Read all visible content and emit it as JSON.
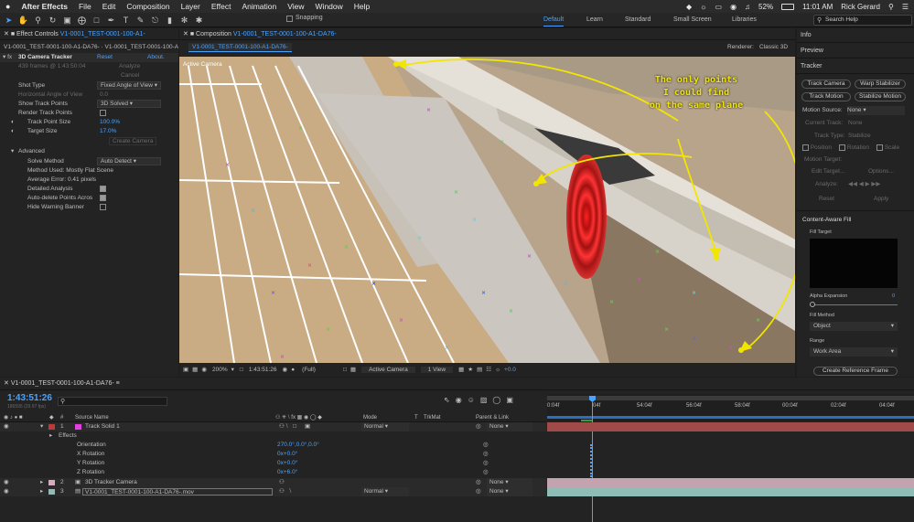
{
  "menubar": {
    "apple": "",
    "app": "After Effects",
    "items": [
      "File",
      "Edit",
      "Composition",
      "Layer",
      "Effect",
      "Animation",
      "View",
      "Window",
      "Help"
    ],
    "battery": "52%",
    "time": "11:01 AM",
    "user": "Rick Gerard"
  },
  "toolbar": {
    "snapping": "Snapping",
    "workspaces": [
      "Default",
      "Learn",
      "Standard",
      "Small Screen",
      "Libraries"
    ],
    "search_placeholder": "Search Help"
  },
  "effect_panel": {
    "tab": "Effect Controls",
    "tab_layer": "V1-0001_TEST-0001-100-A1-",
    "breadcrumb": "V1-0001_TEST-0001-100-A1-DA76- · V1-0001_TEST-0001-100-A",
    "effect_name": "3D Camera Tracker",
    "reset": "Reset",
    "about": "About.",
    "frames_info": "439 frames @ 1:43:50:04",
    "analyze": "Analyze",
    "cancel": "Cancel",
    "shot_type_label": "Shot Type",
    "shot_type_value": "Fixed Angle of View",
    "hfov_label": "Horizontal Angle of View",
    "hfov_value": "0.0",
    "show_track_points_label": "Show Track Points",
    "show_track_points_value": "3D Solved",
    "render_track_points_label": "Render Track Points",
    "track_point_size_label": "Track Point Size",
    "track_point_size_value": "100.0%",
    "target_size_label": "Target Size",
    "target_size_value": "17.0%",
    "create_camera": "Create Camera",
    "advanced_label": "Advanced",
    "solve_method_label": "Solve Method",
    "solve_method_value": "Auto Detect",
    "method_used": "Method Used: Mostly Flat Scene",
    "average_error": "Average Error: 0.41 pixels",
    "detailed_analysis": "Detailed Analysis",
    "auto_delete": "Auto-delete Points Acros",
    "hide_warning": "Hide Warning Banner"
  },
  "comp_panel": {
    "tab": "Composition",
    "tab_name": "V1-0001_TEST-0001-100-A1-DA76-",
    "subtab": "V1-0001_TEST-0001-100-A1-DA76-",
    "renderer_label": "Renderer:",
    "renderer_value": "Classic 3D",
    "camera_label": "Active Camera",
    "annotation_lines": [
      "The only points",
      "I could find",
      "on the same plane"
    ],
    "zoom": "200%",
    "timecode": "1:43:51:26",
    "resolution": "(Full)",
    "active_camera": "Active Camera",
    "view_layout": "1 View",
    "exposure": "+0.0"
  },
  "right_panel": {
    "info": "Info",
    "preview": "Preview",
    "tracker": "Tracker",
    "track_camera": "Track Camera",
    "warp_stabilizer": "Warp Stabilizer",
    "track_motion": "Track Motion",
    "stabilize_motion": "Stabilize Motion",
    "motion_source_label": "Motion Source:",
    "motion_source_value": "None",
    "current_track_label": "Current Track:",
    "current_track_value": "None",
    "track_type_label": "Track Type:",
    "track_type_value": "Stabilize",
    "position": "Position",
    "rotation": "Rotation",
    "scale": "Scale",
    "motion_target": "Motion Target:",
    "edit_target": "Edit Target...",
    "options": "Options...",
    "analyze": "Analyze:",
    "reset": "Reset",
    "apply": "Apply",
    "caf": "Content-Aware Fill",
    "fill_target": "Fill Target",
    "alpha_expansion": "Alpha Expansion",
    "alpha_value": "0",
    "fill_method": "Fill Method",
    "fill_method_value": "Object",
    "range": "Range",
    "range_value": "Work Area",
    "create_reference_frame": "Create Reference Frame"
  },
  "timeline": {
    "tab": "V1-0001_TEST-0001-100-A1-DA76-",
    "timecode": "1:43:51:26",
    "frame_info": "186595 (29.97 fps)",
    "search_placeholder": "",
    "col_source_name": "Source Name",
    "col_mode": "Mode",
    "col_t": "T",
    "col_trkmat": "TrkMat",
    "col_parent": "Parent & Link",
    "ruler": [
      "0:04f",
      "04f",
      "54:04f",
      "56:04f",
      "58:04f",
      "00:04f",
      "02:04f",
      "04:04f"
    ],
    "layers": [
      {
        "num": "1",
        "name": "Track Solid 1",
        "mode": "Normal",
        "parent": "None"
      },
      {
        "num": "2",
        "name": "3D Tracker Camera",
        "mode": "",
        "parent": "None"
      },
      {
        "num": "3",
        "name": "V1-0001_TEST-0001-100-A1-DA76-.mov",
        "mode": "Normal",
        "parent": "None"
      }
    ],
    "effects_label": "Effects",
    "props": [
      {
        "name": "Orientation",
        "value": "270.0°,0.0°,0.0°"
      },
      {
        "name": "X Rotation",
        "value": "0x+0.0°"
      },
      {
        "name": "Y Rotation",
        "value": "0x+0.0°"
      },
      {
        "name": "Z Rotation",
        "value": "0x+6.0°"
      }
    ]
  },
  "colors": {
    "accent": "#4aa3ff",
    "annotation": "#f2e600",
    "layer1_bar": "#a04a4a",
    "layer2_bar": "#c4a3b0",
    "layer3_bar": "#8fbdb6"
  }
}
